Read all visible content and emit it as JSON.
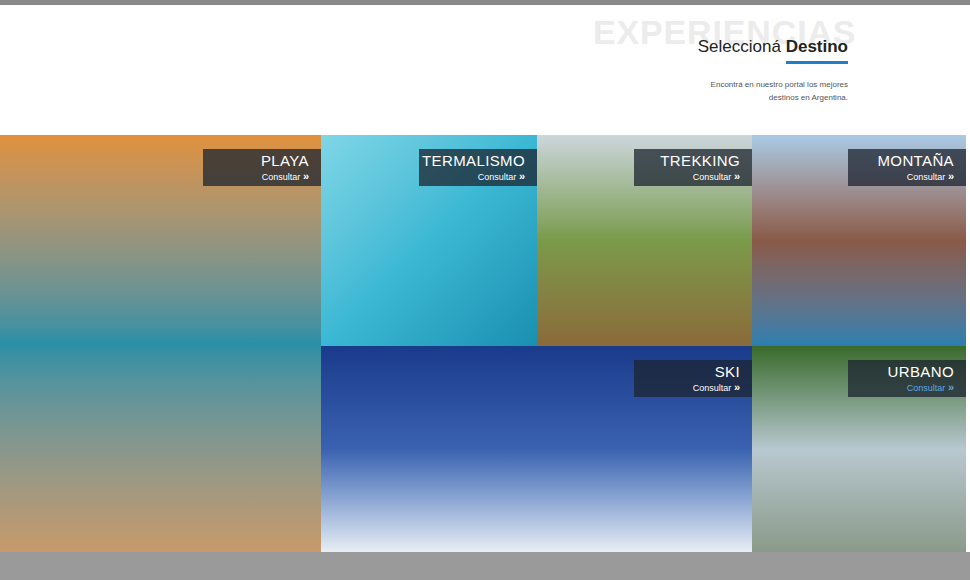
{
  "header": {
    "watermark": "EXPERIENCIAS",
    "title_normal": "Seleccioná",
    "title_bold": "Destino",
    "subtitle_lines": [
      "Encontrá en nuestro portal los mejores",
      "destinos en Argentina."
    ]
  },
  "tiles": [
    {
      "title": "PLAYA",
      "action": "Consultar",
      "arrow": "»",
      "hover": false
    },
    {
      "title": "TERMALISMO",
      "action": "Consultar",
      "arrow": "»",
      "hover": false
    },
    {
      "title": "TREKKING",
      "action": "Consultar",
      "arrow": "»",
      "hover": false
    },
    {
      "title": "MONTAÑA",
      "action": "Consultar",
      "arrow": "»",
      "hover": false
    },
    {
      "title": "SKI",
      "action": "Consultar",
      "arrow": "»",
      "hover": false
    },
    {
      "title": "URBANO",
      "action": "Consultar",
      "arrow": "»",
      "hover": true
    }
  ]
}
